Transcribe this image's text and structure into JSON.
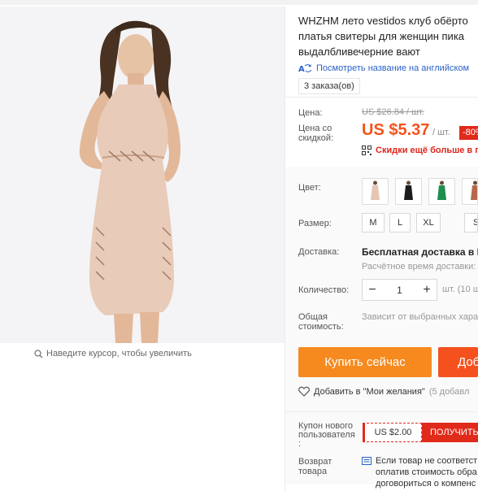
{
  "product": {
    "title_lines": [
      "WHZHM лето vestidos клуб обёрто",
      "платья свитеры для женщин пика",
      "выдалбливечерние вают"
    ],
    "translate_link": "Посмотреть название на английском",
    "orders": "3 заказа(ов)",
    "zoom_hint": "Наведите курсор, чтобы увеличить",
    "main_image_icon": "dress-photo"
  },
  "price": {
    "label": "Цена:",
    "old": "US $26.84 / шт.",
    "discount_label_line1": "Цена со",
    "discount_label_line2": "скидкой:",
    "current": "US $5.37",
    "unit": "/ шт.",
    "discount_badge": "-80%",
    "promo": "Скидки ещё больше в пр"
  },
  "options": {
    "color_label": "Цвет:",
    "colors": [
      {
        "name": "beige",
        "hex": "#e6c5b4"
      },
      {
        "name": "black",
        "hex": "#1c1c1c"
      },
      {
        "name": "green",
        "hex": "#1c8f4e"
      },
      {
        "name": "brown",
        "hex": "#b46a4a"
      }
    ],
    "size_label": "Размер:",
    "sizes": [
      "M",
      "L",
      "XL",
      "S"
    ],
    "shipping_label": "Доставка:",
    "shipping_value": "Бесплатная доставка в Ru",
    "shipping_estimate": "Расчётное время доставки:",
    "quantity_label": "Количество:",
    "quantity_value": "1",
    "quantity_minus": "−",
    "quantity_plus": "+",
    "quantity_available": "шт. (10 ш",
    "total_label_line1": "Общая",
    "total_label_line2": "стоимость:",
    "total_value": "Зависит от выбранных хара"
  },
  "actions": {
    "buy_now": "Купить сейчас",
    "add_to_cart": "Доб",
    "wishlist": "Добавить в \"Мои желания\"",
    "wishlist_count": "(5 добавл"
  },
  "coupon": {
    "label_line1": "Купон нового",
    "label_line2": "пользователя",
    "label_line3": ":",
    "value": "US $2.00",
    "get_button": "ПОЛУЧИТЬ"
  },
  "returns": {
    "label_line1": "Возврат",
    "label_line2": "товара",
    "lines": [
      "Если товар не соответст",
      "оплатив стоимость обра",
      "договориться о компенс"
    ]
  },
  "colors": {
    "accent_orange": "#f68a1f",
    "price_red": "#f5531d",
    "badge_red": "#e02b1b",
    "link_blue": "#2a62c9"
  }
}
